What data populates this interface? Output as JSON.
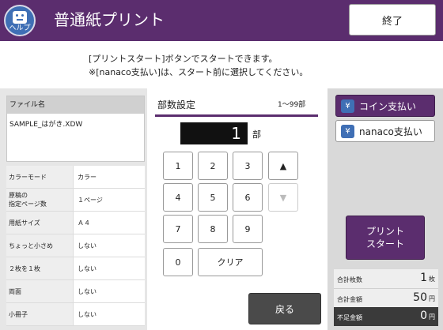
{
  "header": {
    "title": "普通紙プリント",
    "help_label": "ヘルプ",
    "end_label": "終了"
  },
  "messages": {
    "line1": "[プリントスタート]ボタンでスタートできます。",
    "line2": "※[nanaco支払い]は、スタート前に選択してください。"
  },
  "file": {
    "header": "ファイル名",
    "name": "SAMPLE_はがき.XDW"
  },
  "settings": [
    {
      "key": "カラーモード",
      "value": "カラー"
    },
    {
      "key": "原稿の\n指定ページ数",
      "value": "１ページ"
    },
    {
      "key": "用紙サイズ",
      "value": "Ａ４"
    },
    {
      "key": "ちょっと小さめ",
      "value": "しない"
    },
    {
      "key": "２枚を１枚",
      "value": "しない"
    },
    {
      "key": "両面",
      "value": "しない"
    },
    {
      "key": "小冊子",
      "value": "しない"
    }
  ],
  "quantity": {
    "title": "部数設定",
    "range": "1〜99部",
    "value": "1",
    "unit": "部"
  },
  "keypad": {
    "k1": "1",
    "k2": "2",
    "k3": "3",
    "k4": "4",
    "k5": "5",
    "k6": "6",
    "k7": "7",
    "k8": "8",
    "k9": "9",
    "k0": "0",
    "clear": "クリア",
    "up": "▲",
    "down": "▼"
  },
  "back_label": "戻る",
  "payment": {
    "yen_symbol": "¥",
    "coin_label": "コイン支払い",
    "nanaco_label": "nanaco支払い"
  },
  "print_start": {
    "line1": "プリント",
    "line2": "スタート"
  },
  "summary": {
    "total_sheets_label": "合計枚数",
    "total_sheets_value": "1",
    "total_sheets_unit": "枚",
    "total_amount_label": "合計金額",
    "total_amount_value": "50",
    "total_amount_unit": "円",
    "shortage_label": "不足金額",
    "shortage_value": "0",
    "shortage_unit": "円"
  },
  "colors": {
    "header_bg": "#5b2d6e",
    "accent": "#5b2d6e",
    "help_blue": "#3f6fb5"
  }
}
